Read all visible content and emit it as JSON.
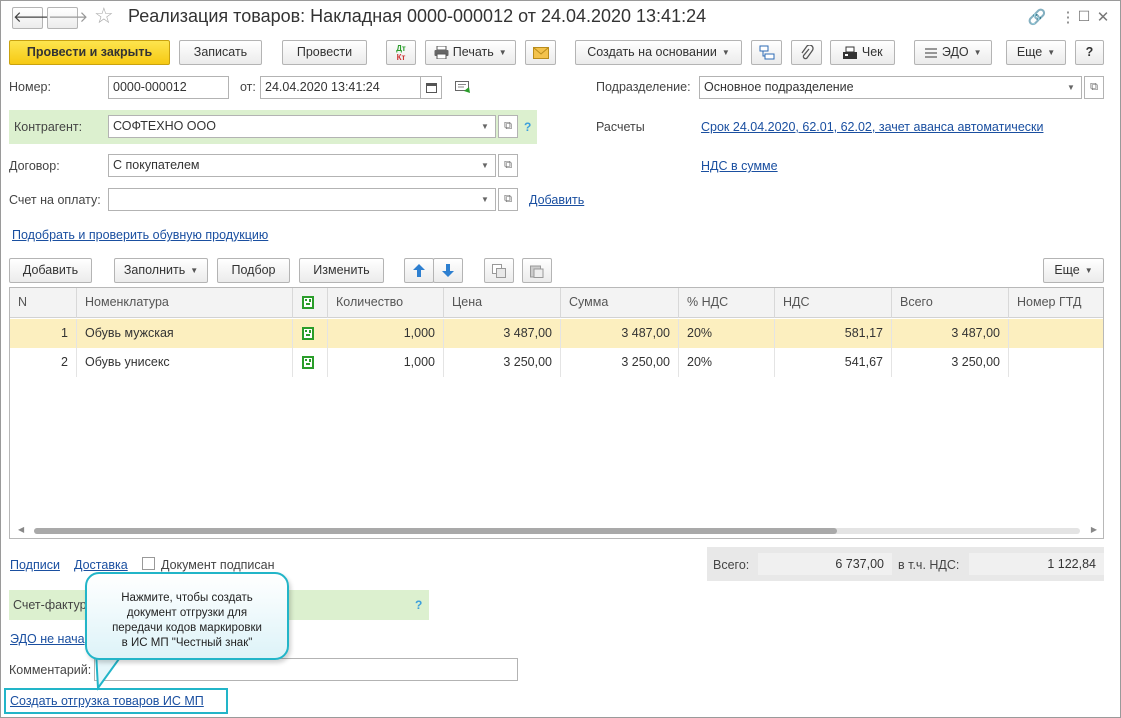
{
  "window": {
    "title": "Реализация товаров: Накладная 0000-000012 от 24.04.2020 13:41:24",
    "back_glyph": "🡐",
    "forward_glyph": "🡒",
    "star_glyph": "☆",
    "link_glyph": "🔗",
    "menu_glyph": "⋮",
    "maximize_glyph": "☐",
    "close_glyph": "✕"
  },
  "toolbar": {
    "post_close": "Провести и закрыть",
    "save": "Записать",
    "post": "Провести",
    "dtkt_top": "Дт",
    "dtkt_bottom": "Кт",
    "print": "Печать",
    "create_based": "Создать на основании",
    "check": "Чек",
    "edo": "ЭДО",
    "more": "Еще",
    "help": "?"
  },
  "form": {
    "number_label": "Номер:",
    "number_value": "0000-000012",
    "from_label": "от:",
    "date_value": "24.04.2020 13:41:24",
    "division_label": "Подразделение:",
    "division_value": "Основное подразделение",
    "contractor_label": "Контрагент:",
    "contractor_value": "СОФТЕХНО ООО",
    "help_mark": "?",
    "settlements_label": "Расчеты",
    "settlements_link": "Срок 24.04.2020, 62.01, 62.02, зачет аванса автоматически",
    "contract_label": "Договор:",
    "contract_value": "С покупателем",
    "vat_link": "НДС в сумме",
    "invoice_label": "Счет на оплату:",
    "invoice_value": "",
    "add_link": "Добавить",
    "shoe_link": "Подобрать и проверить обувную продукцию"
  },
  "table_toolbar": {
    "add": "Добавить",
    "fill": "Заполнить",
    "pick": "Подбор",
    "change": "Изменить",
    "more": "Еще"
  },
  "table": {
    "columns": [
      "N",
      "Номенклатура",
      "",
      "Количество",
      "Цена",
      "Сумма",
      "% НДС",
      "НДС",
      "Всего",
      "Номер ГТД"
    ],
    "rows": [
      {
        "n": "1",
        "name": "Обувь мужская",
        "qty": "1,000",
        "price": "3 487,00",
        "sum": "3 487,00",
        "vat_rate": "20%",
        "vat": "581,17",
        "total": "3 487,00",
        "gtd": ""
      },
      {
        "n": "2",
        "name": "Обувь унисекс",
        "qty": "1,000",
        "price": "3 250,00",
        "sum": "3 250,00",
        "vat_rate": "20%",
        "vat": "541,67",
        "total": "3 250,00",
        "gtd": ""
      }
    ]
  },
  "footer": {
    "signatures_link": "Подписи",
    "delivery_link": "Доставка",
    "signed_label": "Документ подписан",
    "total_label": "Всего:",
    "total_value": "6 737,00",
    "vat_label": "в т.ч. НДС:",
    "vat_value": "1 122,84",
    "invoice_factura_label": "Счет-фактура",
    "help_mark": "?",
    "edo_link": "ЭДО не нача",
    "comment_label": "Комментарий:",
    "comment_value": "",
    "create_shipment_link": "Создать отгрузка товаров ИС МП"
  },
  "callout": {
    "line1": "Нажмите, чтобы создать",
    "line2": "документ отгрузки для",
    "line3": "передачи кодов маркировки",
    "line4": "в ИС МП \"Честный знак\""
  },
  "colors": {
    "primary_button": "#f8d01f",
    "highlight_green": "#dcf0cf",
    "selected_row": "#fcefbf",
    "link": "#1a4fa0",
    "callout_border": "#22b5c8"
  }
}
